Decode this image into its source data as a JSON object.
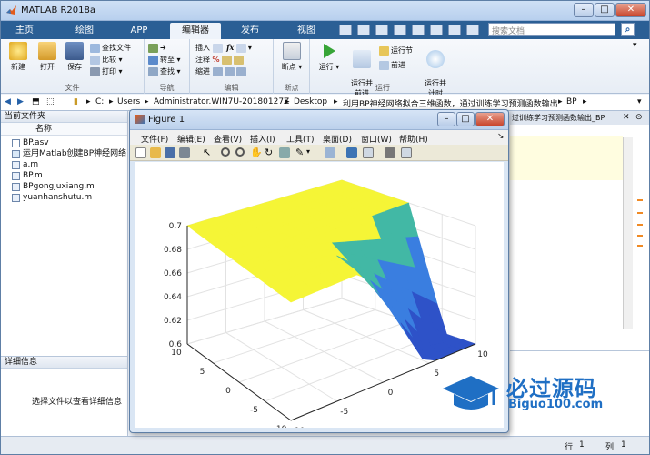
{
  "app": {
    "title": "MATLAB R2018a"
  },
  "tabs": [
    "主页",
    "绘图",
    "APP",
    "编辑器",
    "发布",
    "视图"
  ],
  "search": {
    "placeholder": "搜索文档"
  },
  "ribbon": {
    "file": {
      "label": "文件",
      "new": "新建",
      "open": "打开",
      "save": "保存",
      "find_files": "查找文件",
      "compare": "比较",
      "print": "打印"
    },
    "navigate": {
      "label": "导航",
      "goto": "转至",
      "find": "查找"
    },
    "edit": {
      "label": "编辑",
      "insert": "插入",
      "comment": "注释",
      "indent": "缩进"
    },
    "breakpoints": {
      "label": "断点",
      "breakpoints_btn": "断点"
    },
    "run": {
      "label": "运行",
      "run": "运行",
      "run_advance": "运行并\n前进",
      "run_section": "运行节",
      "advance": "前进",
      "run_time": "运行并\n计时"
    }
  },
  "address": {
    "crumbs": [
      "C:",
      "Users",
      "Administrator.WIN7U-20180127Z",
      "Desktop",
      "利用BP神经网络拟合三维函数，通过训练学习预测函数输出",
      "BP"
    ]
  },
  "current_folder": {
    "header": "当前文件夹",
    "column": "名称",
    "files": [
      "BP.asv",
      "运用Matlab创建BP神经网络",
      "a.m",
      "BP.m",
      "BPgongjuxiang.m",
      "yuanhanshutu.m"
    ]
  },
  "details": {
    "header": "详细信息",
    "message": "选择文件以查看详细信息"
  },
  "editor": {
    "tab_title": "过训练学习预测函数输出_BP"
  },
  "status": {
    "row_label": "行",
    "row_value": "1",
    "col_label": "列",
    "col_value": "1"
  },
  "figure": {
    "title": "Figure 1",
    "menu": [
      "文件(F)",
      "编辑(E)",
      "查看(V)",
      "插入(I)",
      "工具(T)",
      "桌面(D)",
      "窗口(W)",
      "帮助(H)"
    ]
  },
  "chart_data": {
    "type": "surface",
    "title": "",
    "xlabel": "",
    "ylabel": "",
    "zlabel": "",
    "zticks": [
      "0.6",
      "0.62",
      "0.64",
      "0.66",
      "0.68",
      "0.7"
    ],
    "xticks": [
      "-10",
      "-5",
      "0",
      "5",
      "10"
    ],
    "yticks": [
      "-10",
      "-5",
      "0",
      "5",
      "10"
    ],
    "xlim": [
      -10,
      10
    ],
    "ylim": [
      -10,
      10
    ],
    "zlim": [
      0.6,
      0.7
    ],
    "surface_colors": [
      "#f5f536",
      "#42b8a5",
      "#3a7ee0",
      "#2e52c8"
    ],
    "grid": true
  },
  "watermark": {
    "text_cn": "必过源码",
    "text_en": "Biguo100.com"
  },
  "colors": {
    "accent": "#2b5f95",
    "highlight": "#fffde0",
    "surface_top": "#f5f536"
  }
}
